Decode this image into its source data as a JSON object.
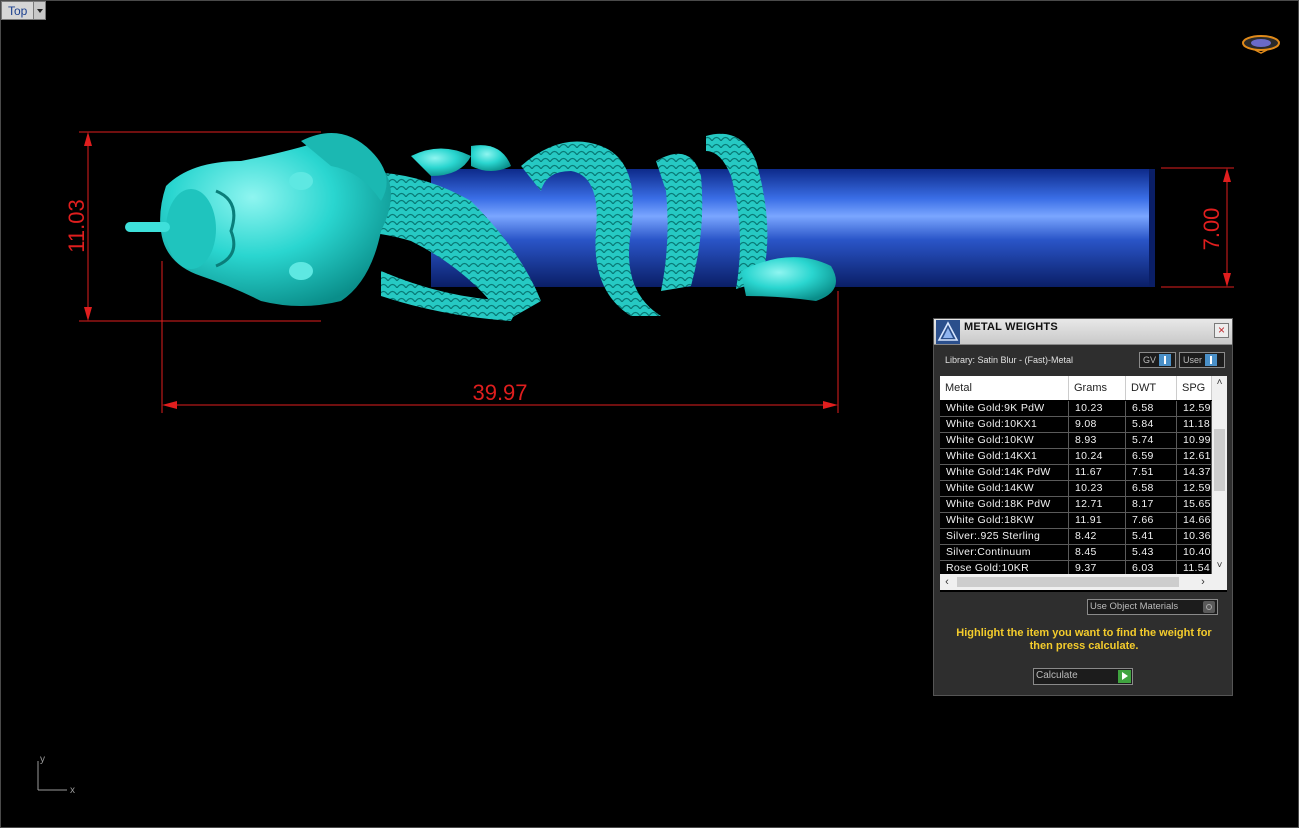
{
  "viewport": {
    "name": "Top",
    "axis_y": "y",
    "axis_x": "x"
  },
  "dimensions": {
    "height_left": "11.03",
    "height_right": "7.00",
    "length": "39.97"
  },
  "colors": {
    "dimension": "#e01e1e",
    "dragon": "#2ad6d0",
    "cylinder": "#1e44b8",
    "hint_text": "#f4cc2c"
  },
  "panel": {
    "title": "METAL WEIGHTS",
    "close_icon": "close-icon",
    "library": "Library: Satin Blur - (Fast)-Metal",
    "gv_label": "GV",
    "user_label": "User",
    "columns": [
      "Metal",
      "Grams",
      "DWT",
      "SPG"
    ],
    "rows": [
      {
        "metal": "White Gold:9K PdW",
        "grams": "10.23",
        "dwt": "6.58",
        "spg": "12.59"
      },
      {
        "metal": "White Gold:10KX1",
        "grams": "9.08",
        "dwt": "5.84",
        "spg": "11.18"
      },
      {
        "metal": "White Gold:10KW",
        "grams": "8.93",
        "dwt": "5.74",
        "spg": "10.99"
      },
      {
        "metal": "White Gold:14KX1",
        "grams": "10.24",
        "dwt": "6.59",
        "spg": "12.61"
      },
      {
        "metal": "White Gold:14K PdW",
        "grams": "11.67",
        "dwt": "7.51",
        "spg": "14.37"
      },
      {
        "metal": "White Gold:14KW",
        "grams": "10.23",
        "dwt": "6.58",
        "spg": "12.59"
      },
      {
        "metal": "White Gold:18K PdW",
        "grams": "12.71",
        "dwt": "8.17",
        "spg": "15.65"
      },
      {
        "metal": "White Gold:18KW",
        "grams": "11.91",
        "dwt": "7.66",
        "spg": "14.66"
      },
      {
        "metal": "Silver:.925 Sterling",
        "grams": "8.42",
        "dwt": "5.41",
        "spg": "10.36"
      },
      {
        "metal": "Silver:Continuum",
        "grams": "8.45",
        "dwt": "5.43",
        "spg": "10.40"
      },
      {
        "metal": "Rose Gold:10KR",
        "grams": "9.37",
        "dwt": "6.03",
        "spg": "11.54"
      }
    ],
    "use_object_materials": "Use Object Materials",
    "hint": "Highlight the item you want to find the weight for then press calculate.",
    "calculate_label": "Calculate"
  }
}
